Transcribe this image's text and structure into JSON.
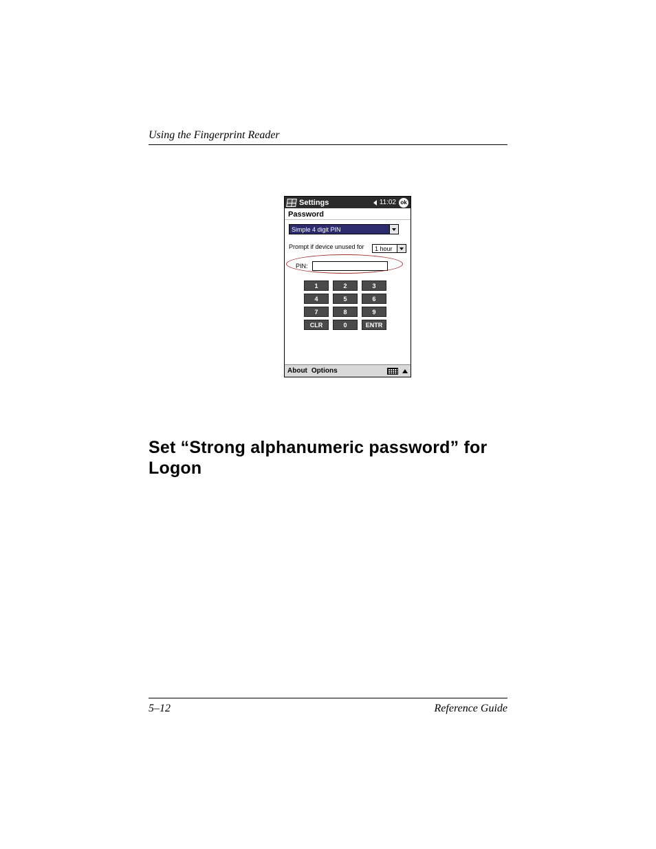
{
  "page": {
    "running_header": "Using the Fingerprint Reader",
    "section_heading": "Set “Strong alphanumeric password” for Logon",
    "footer_page": "5–12",
    "footer_title": "Reference Guide"
  },
  "shot": {
    "titlebar": {
      "title": "Settings",
      "time": "11:02",
      "ok": "ok"
    },
    "subheader": "Password",
    "password_type_selected": "Simple 4 digit PIN",
    "prompt_label": "Prompt if device unused for",
    "prompt_value": "1 hour",
    "pin_label": "PIN:",
    "pin_value": "",
    "keypad": [
      "1",
      "2",
      "3",
      "4",
      "5",
      "6",
      "7",
      "8",
      "9",
      "CLR",
      "0",
      "ENTR"
    ],
    "menubar": {
      "about": "About",
      "options": "Options"
    }
  }
}
